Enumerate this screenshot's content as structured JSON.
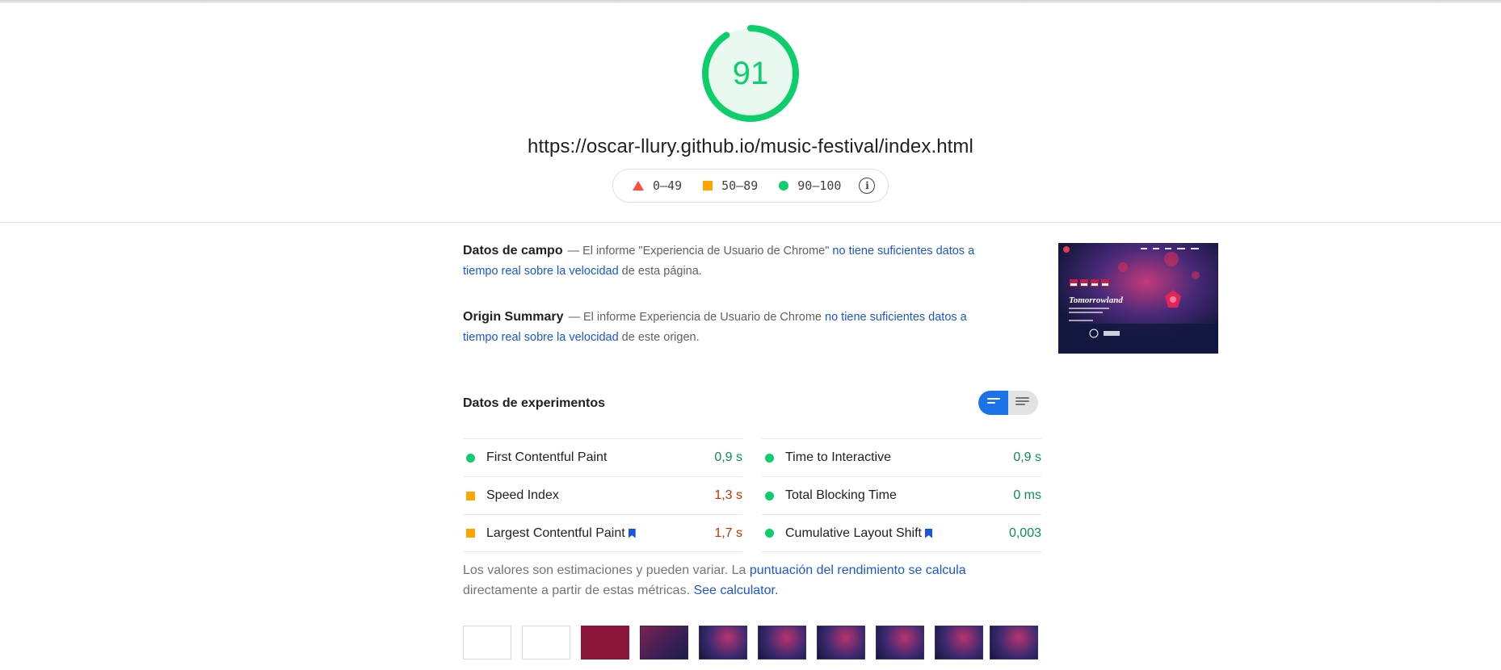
{
  "score": {
    "value": "91",
    "fraction": 0.91,
    "color": "#0cce6b"
  },
  "url": "https://oscar-llury.github.io/music-festival/index.html",
  "legend": {
    "fail": "0–49",
    "average": "50–89",
    "pass": "90–100"
  },
  "field": {
    "title": "Datos de campo",
    "text_before": "— El informe \"Experiencia de Usuario de Chrome\" ",
    "link": "no tiene suficientes datos a tiempo real sobre la velocidad",
    "text_after": " de esta página."
  },
  "origin": {
    "title": "Origin Summary",
    "text_before": "— El informe Experiencia de Usuario de Chrome ",
    "link": "no tiene suficientes datos a tiempo real sobre la velocidad",
    "text_after": " de este origen."
  },
  "screenshot": {
    "brand": "Tomorrowland",
    "nav": [
      "Inicio",
      "Festival",
      "Artistas",
      "Entradas",
      "Contacto"
    ]
  },
  "lab": {
    "title": "Datos de experimentos",
    "metrics_left": [
      {
        "name": "First Contentful Paint",
        "value": "0,9 s",
        "status": "pass",
        "bookmark": false
      },
      {
        "name": "Speed Index",
        "value": "1,3 s",
        "status": "average",
        "bookmark": false
      },
      {
        "name": "Largest Contentful Paint",
        "value": "1,7 s",
        "status": "average",
        "bookmark": true
      }
    ],
    "metrics_right": [
      {
        "name": "Time to Interactive",
        "value": "0,9 s",
        "status": "pass",
        "bookmark": false
      },
      {
        "name": "Total Blocking Time",
        "value": "0 ms",
        "status": "pass",
        "bookmark": false
      },
      {
        "name": "Cumulative Layout Shift",
        "value": "0,003",
        "status": "pass",
        "bookmark": true
      }
    ]
  },
  "note": {
    "text1": "Los valores son estimaciones y pueden variar. La ",
    "link1": "puntuación del rendimiento se calcula",
    "text2": " directamente a partir de estas métricas. ",
    "link2": "See calculator."
  },
  "colors": {
    "pass": "#0cce6b",
    "average": "#ffa400",
    "fail": "#ff4e42",
    "link": "#1a56db"
  }
}
